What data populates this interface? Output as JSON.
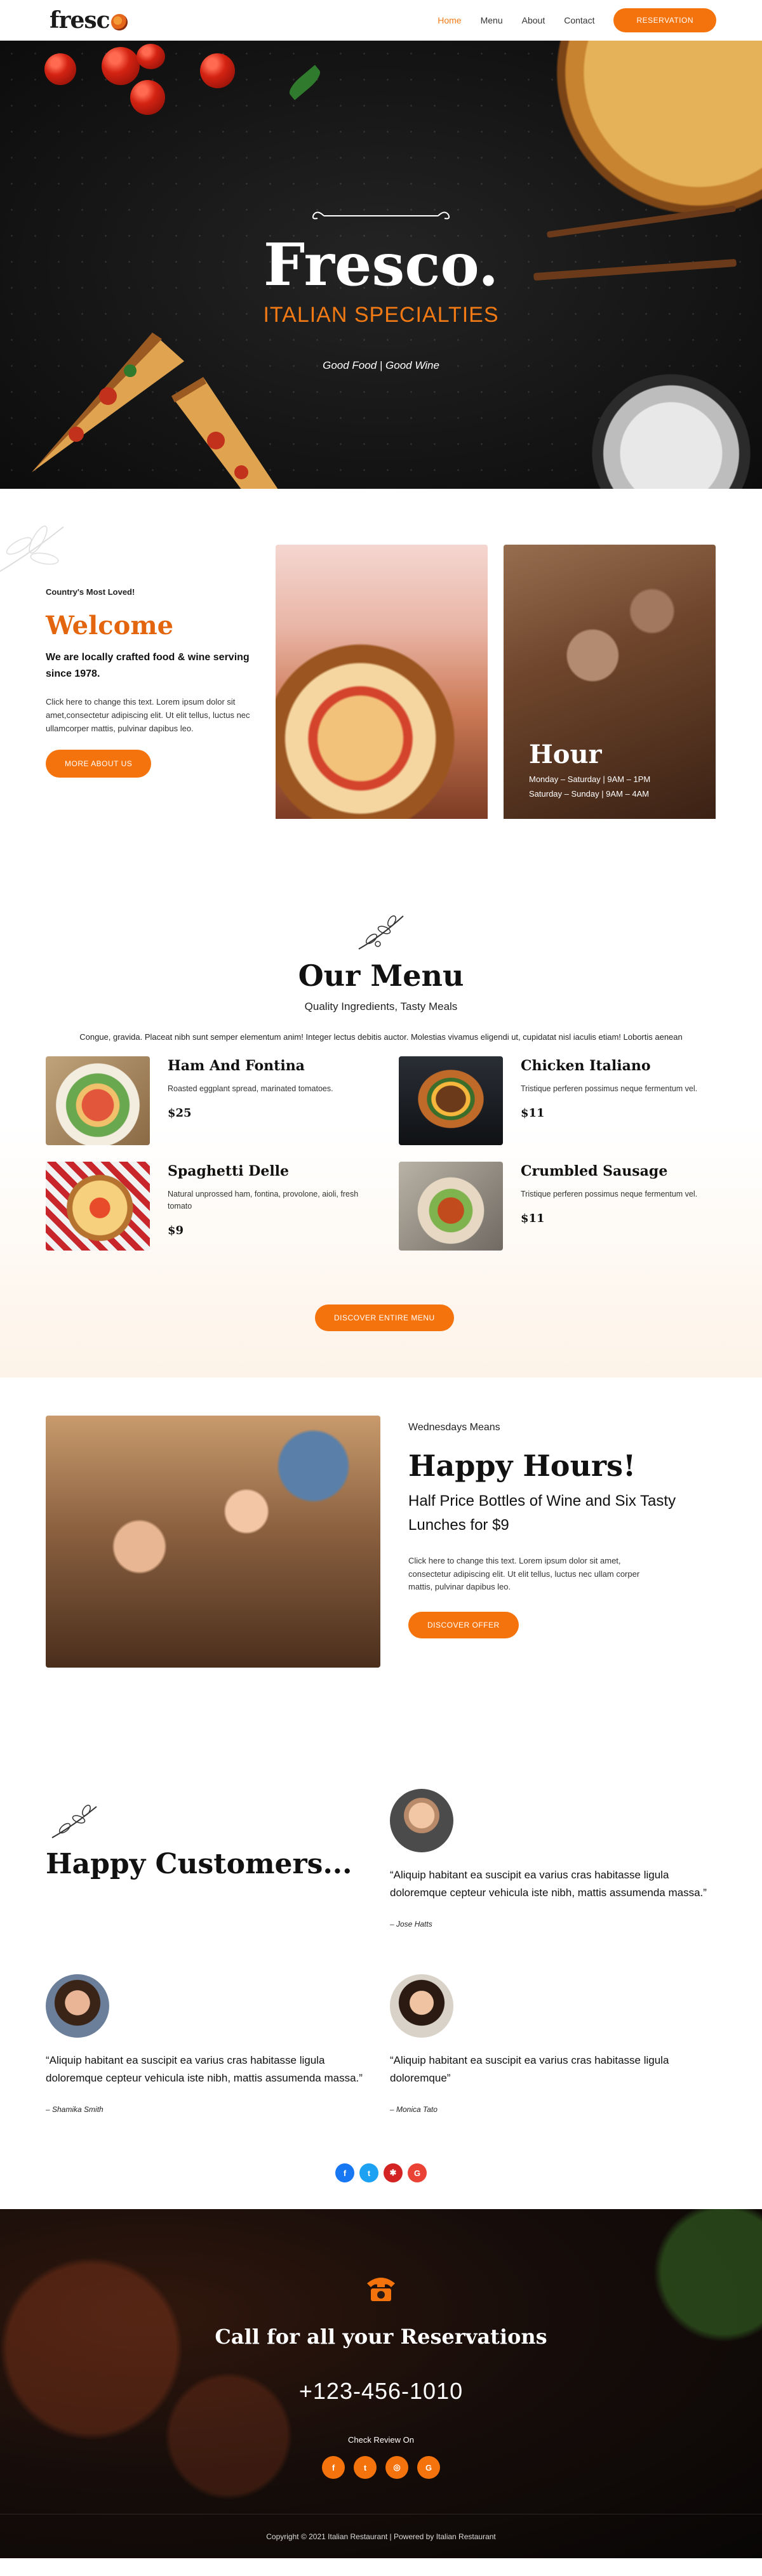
{
  "header": {
    "logo": "fresc",
    "nav": [
      "Home",
      "Menu",
      "About",
      "Contact"
    ],
    "cta": "Reservation"
  },
  "hero": {
    "title": "Fresco.",
    "subtitle": "ITALIAN SPECIALTIES",
    "tagline": "Good Food | Good Wine"
  },
  "welcome": {
    "eyebrow": "Country's Most Loved!",
    "title": "Welcome",
    "lead": "We are locally crafted food & wine serving since 1978.",
    "body": "Click here to change this text. Lorem ipsum dolor sit amet,consectetur adipiscing elit. Ut elit tellus, luctus nec ullamcorper mattis, pulvinar dapibus leo.",
    "button": "More About Us",
    "hour_title": "Hour",
    "hour_lines": [
      "Monday – Saturday | 9AM – 1PM",
      "Saturday – Sunday | 9AM – 4AM"
    ]
  },
  "menu": {
    "title": "Our Menu",
    "subtitle": "Quality Ingredients, Tasty Meals",
    "description": "Congue, gravida. Placeat nibh sunt semper elementum anim! Integer lectus debitis auctor. Molestias vivamus eligendi ut, cupidatat nisl iaculis etiam! Lobortis aenean",
    "items": [
      {
        "name": "Ham And Fontina",
        "desc": "Roasted eggplant spread, marinated tomatoes.",
        "price": "$25"
      },
      {
        "name": "Chicken Italiano",
        "desc": "Tristique perferen possimus neque fermentum vel.",
        "price": "$11"
      },
      {
        "name": "Spaghetti Delle",
        "desc": "Natural unprossed ham, fontina, provolone, aioli, fresh tomato",
        "price": "$9"
      },
      {
        "name": "Crumbled Sausage",
        "desc": "Tristique perferen possimus neque fermentum vel.",
        "price": "$11"
      }
    ],
    "button": "Discover Entire Menu"
  },
  "happy": {
    "eyebrow": "Wednesdays Means",
    "title": "Happy Hours!",
    "lead": "Half Price Bottles of Wine and Six Tasty Lunches for $9",
    "body": "Click here to change this text. Lorem ipsum dolor sit amet, consectetur adipiscing elit. Ut elit tellus, luctus nec ullam corper mattis, pulvinar dapibus leo.",
    "button": "Discover Offer"
  },
  "customers": {
    "title": "Happy Customers...",
    "reviews": [
      {
        "quote": "“Aliquip habitant ea suscipit ea varius cras habitasse ligula doloremque cepteur vehicula iste nibh, mattis assumenda massa.”",
        "author": "– Jose Hatts"
      },
      {
        "quote": "“Aliquip habitant ea suscipit ea varius cras habitasse ligula doloremque cepteur vehicula iste nibh, mattis assumenda massa.”",
        "author": "– Shamika Smith"
      },
      {
        "quote": "“Aliquip habitant ea suscipit ea varius cras habitasse ligula doloremque”",
        "author": "– Monica Tato"
      }
    ]
  },
  "reservation": {
    "title": "Call for all your Reservations",
    "phone": "+123-456-1010",
    "review_label": "Check Review On",
    "footer": "Copyright © 2021 Italian Restaurant | Powered by Italian Restaurant"
  },
  "colors": {
    "accent": "#f5730c",
    "welcome_title": "#e3650e"
  },
  "icons": {
    "social": [
      "facebook-icon",
      "twitter-icon",
      "yelp-icon",
      "google-icon"
    ],
    "reservation_social": [
      "facebook-icon",
      "twitter-icon",
      "tripadvisor-icon",
      "google-icon"
    ]
  }
}
